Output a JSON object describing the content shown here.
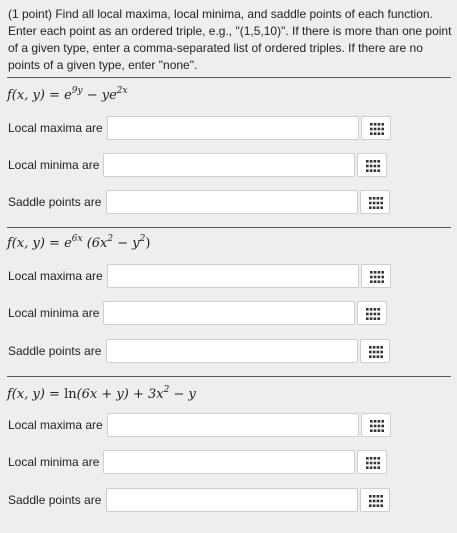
{
  "intro": "(1 point) Find all local maxima, local minima, and saddle points of each function. Enter each point as an ordered triple, e.g., \"(1,5,10)\". If there is more than one point of a given type, enter a comma-separated list of ordered triples. If there are no points of a given type, enter \"none\".",
  "problems": [
    {
      "func_lhs": "f(x, y) = ",
      "func_rhs": {
        "a": "e",
        "a_exp": "9y",
        "minus": " − ",
        "b": "ye",
        "b_exp": "2x"
      },
      "rows": [
        {
          "label": "Local maxima are",
          "value": ""
        },
        {
          "label": "Local minima are",
          "value": ""
        },
        {
          "label": "Saddle points are",
          "value": ""
        }
      ]
    },
    {
      "func_lhs": "f(x, y) = ",
      "func_rhs": {
        "a": "e",
        "a_exp": "6x",
        "rest_open": " (6x",
        "sq1": "2",
        "minus": " − y",
        "sq2": "2",
        "rest_close": ")"
      },
      "rows": [
        {
          "label": "Local maxima are",
          "value": ""
        },
        {
          "label": "Local minima are",
          "value": ""
        },
        {
          "label": "Saddle points are",
          "value": ""
        }
      ]
    },
    {
      "func_lhs": "f(x, y) = ",
      "func_rhs": {
        "ln": "ln",
        "arg": "(6x + y) + 3x",
        "sq": "2",
        "tail": " − y"
      },
      "rows": [
        {
          "label": "Local maxima are",
          "value": ""
        },
        {
          "label": "Local minima are",
          "value": ""
        },
        {
          "label": "Saddle points are",
          "value": ""
        }
      ]
    }
  ],
  "icons": {
    "answer_helper": "grid-icon"
  }
}
